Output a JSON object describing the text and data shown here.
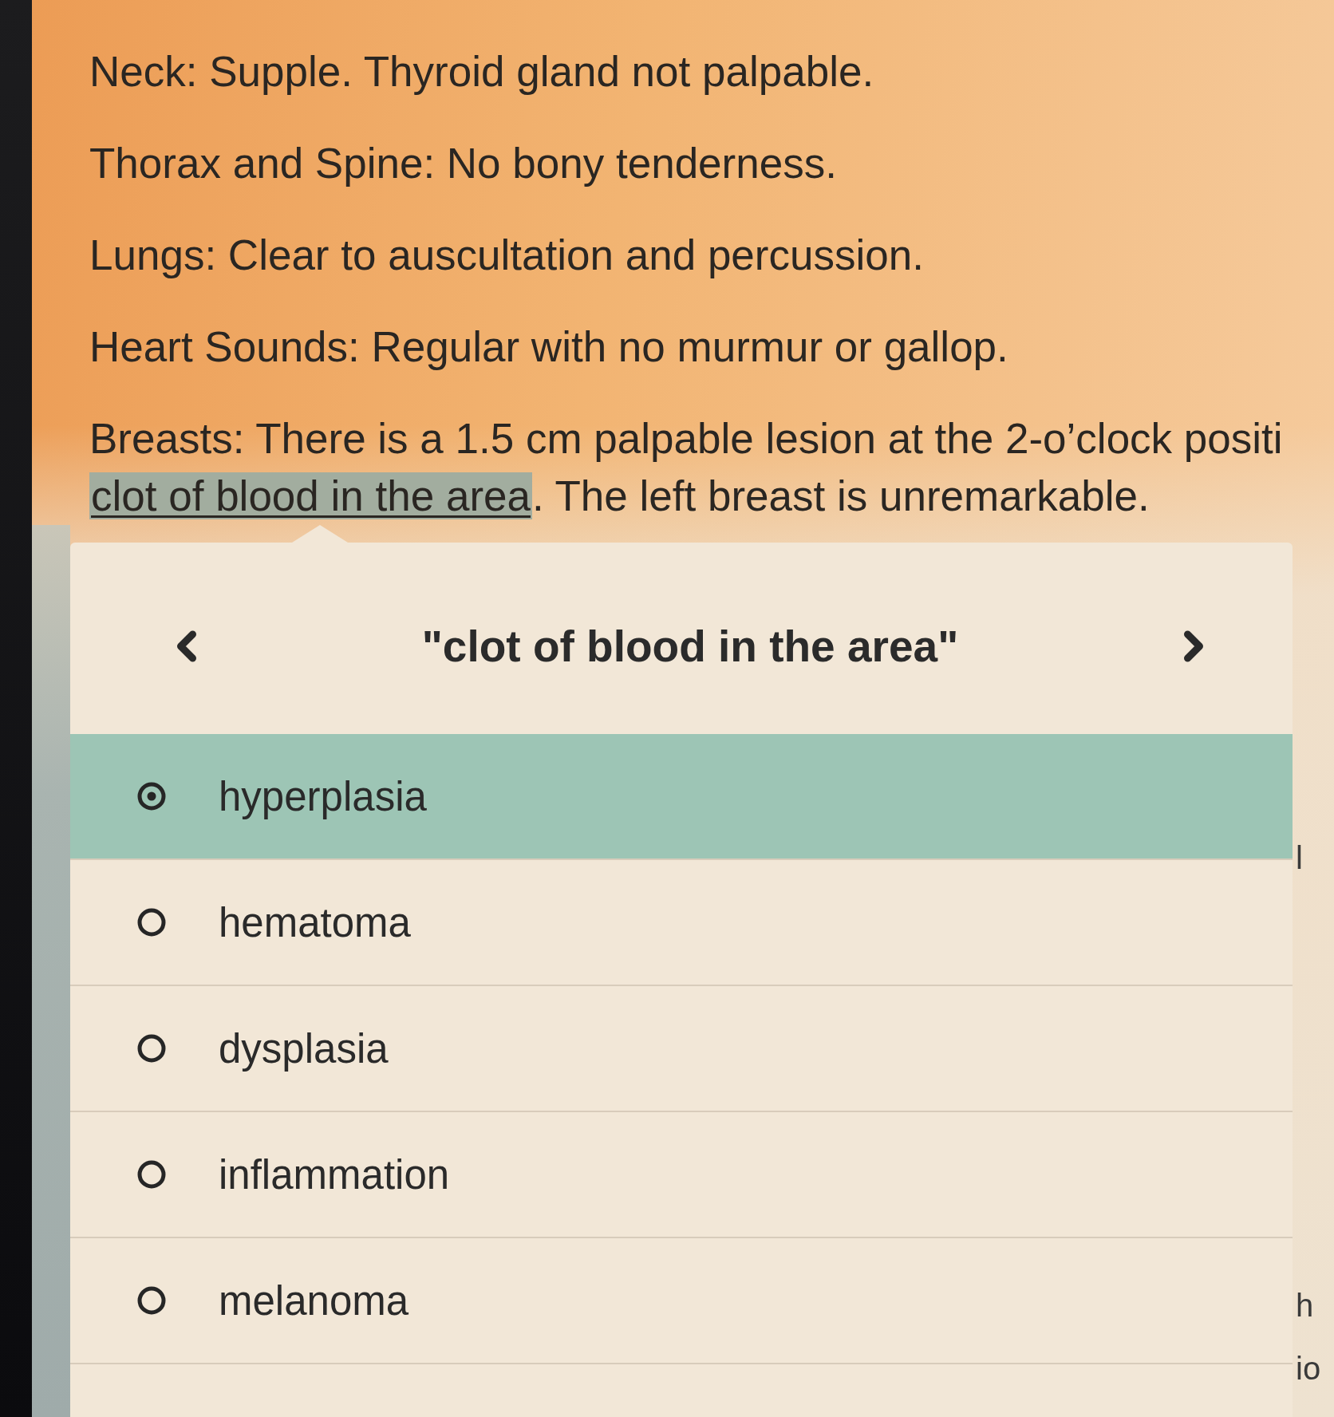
{
  "findings": [
    "Neck: Supple. Thyroid gland not palpable.",
    "Thorax and Spine: No bony tenderness.",
    "Lungs: Clear to auscultation and percussion.",
    "Heart Sounds: Regular with no murmur or gallop."
  ],
  "breasts": {
    "line_1": "Breasts: There is a 1.5 cm palpable lesion at the 2-o’clock positi",
    "highlight": "clot of blood in the area",
    "after_highlight": ". The left breast is unremarkable."
  },
  "popover": {
    "title": "\"clot of blood in the area\"",
    "options": [
      {
        "label": "hyperplasia",
        "selected": true
      },
      {
        "label": "hematoma",
        "selected": false
      },
      {
        "label": "dysplasia",
        "selected": false
      },
      {
        "label": "inflammation",
        "selected": false
      },
      {
        "label": "melanoma",
        "selected": false
      }
    ]
  },
  "edge_fragments": [
    "l",
    "h",
    "io"
  ]
}
